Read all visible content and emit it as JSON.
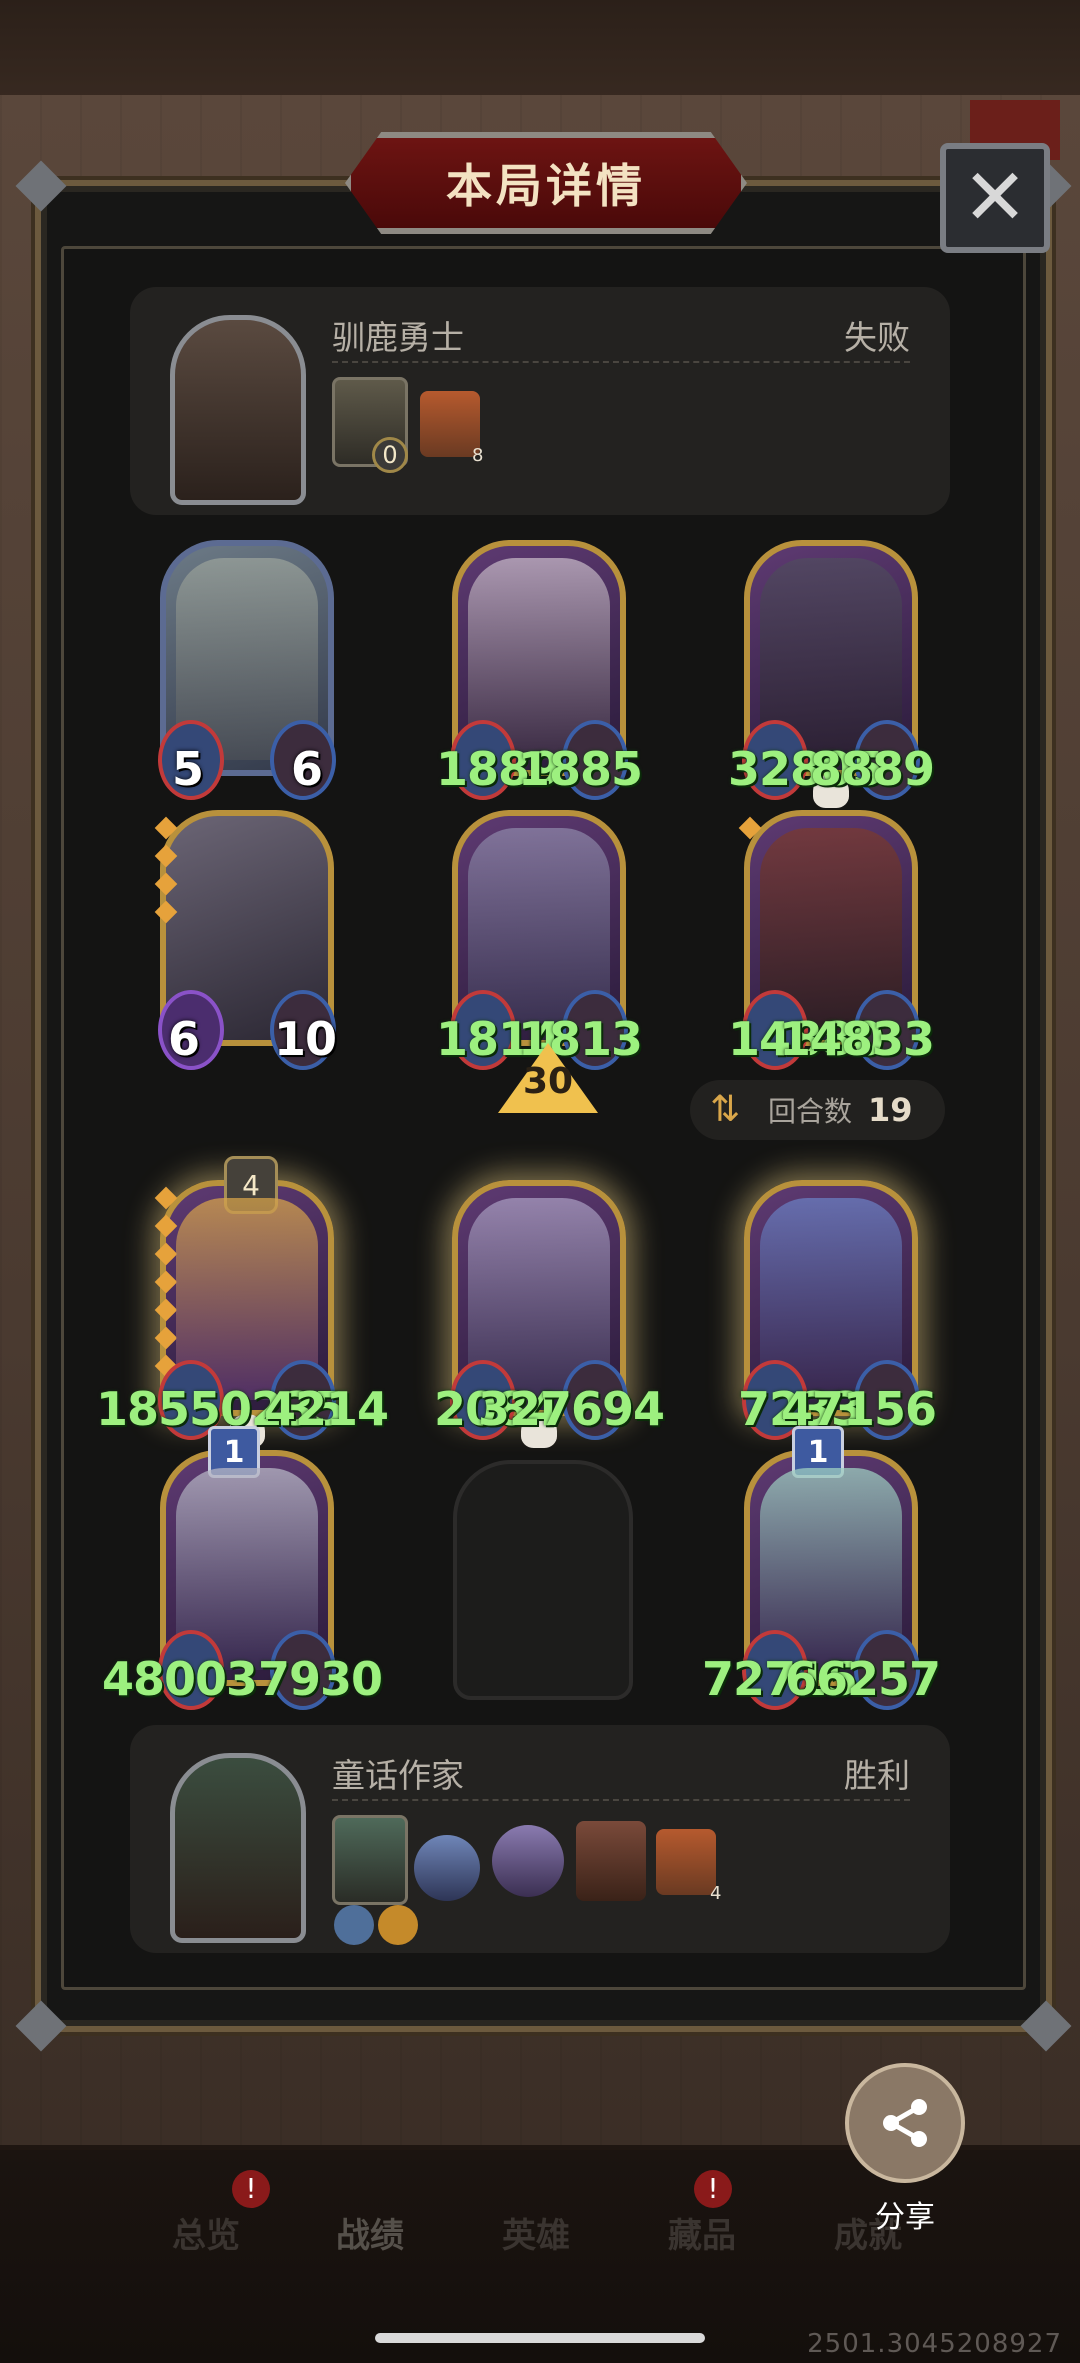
{
  "title": "本局详情",
  "close_icon": "close-icon",
  "opponent": {
    "name": "驯鹿勇士",
    "result": "失败",
    "equip_badge": "0",
    "house_level": "8"
  },
  "rounds": {
    "label": "回合数",
    "value": "19"
  },
  "arrow_value": "30",
  "opponent_board": [
    {
      "atk": "5",
      "hp": "6",
      "style": "white"
    },
    {
      "atk": "1889",
      "hp": "1885"
    },
    {
      "atk": "32805",
      "hp": "8889"
    },
    {
      "atk": "6",
      "hp": "10",
      "style": "white"
    },
    {
      "atk": "1814",
      "hp": "1813"
    },
    {
      "atk": "14880",
      "hp": "14833"
    }
  ],
  "player_board": [
    {
      "atk": "18550235",
      "hp": "4214",
      "star": "4"
    },
    {
      "atk": "2084",
      "hp": "327694"
    },
    {
      "atk": "7233",
      "hp": "47156"
    },
    {
      "atk": "48003",
      "hp": "7930",
      "level": "1"
    },
    {
      "atk": "72715",
      "hp": "66257",
      "level": "1"
    }
  ],
  "player": {
    "name": "童话作家",
    "result": "胜利",
    "house_level": "4"
  },
  "tabs": [
    "总览",
    "战绩",
    "英雄",
    "藏品",
    "成就"
  ],
  "share": {
    "label": "分享"
  },
  "version": "2501.3045208927",
  "colors": {
    "stat_green": "#9df07f",
    "title_red": "#6d1412",
    "gold_border": "#b8913c"
  }
}
